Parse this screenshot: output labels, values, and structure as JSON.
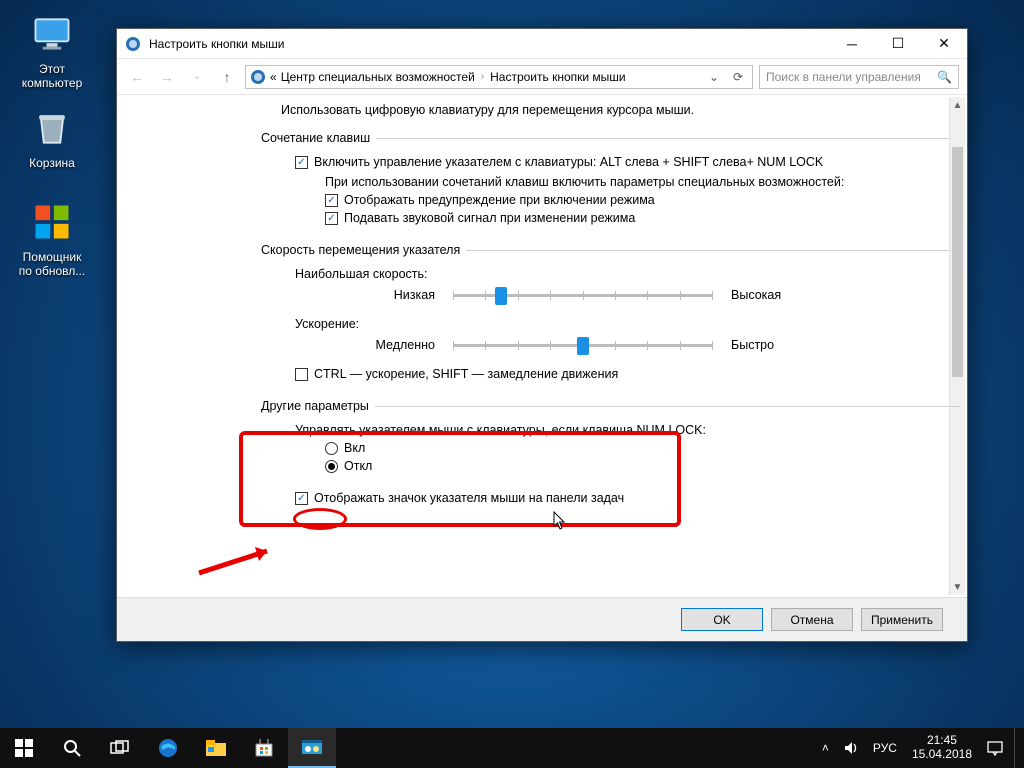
{
  "desktop": {
    "icons": {
      "computer": "Этот\nкомпьютер",
      "bin": "Корзина",
      "helper": "Помощник\nпо обновл..."
    }
  },
  "window": {
    "title": "Настроить кнопки мыши",
    "breadcrumb": {
      "root_sep": "«",
      "parent": "Центр специальных возможностей",
      "current": "Настроить кнопки мыши"
    },
    "search_placeholder": "Поиск в панели управления",
    "intro": "Использовать цифровую клавиатуру для перемещения курсора мыши.",
    "group_keys": {
      "legend": "Сочетание клавиш",
      "enable": "Включить управление указателем с клавиатуры: ALT слева + SHIFT слева+ NUM LOCK",
      "subhead": "При использовании сочетаний клавиш включить параметры специальных возможностей:",
      "warn": "Отображать предупреждение при включении режима",
      "sound": "Подавать звуковой сигнал при изменении режима"
    },
    "group_speed": {
      "legend": "Скорость перемещения указателя",
      "top_speed_label": "Наибольшая скорость:",
      "low": "Низкая",
      "high": "Высокая",
      "accel_label": "Ускорение:",
      "slow": "Медленно",
      "fast": "Быстро",
      "ctrl_shift": "CTRL — ускорение, SHIFT — замедление движения"
    },
    "group_other": {
      "legend": "Другие параметры",
      "subhead": "Управлять указателем мыши с клавиатуры, если клавиша NUM LOCK:",
      "on": "Вкл",
      "off": "Откл",
      "tray_icon": "Отображать значок указателя мыши на панели задач"
    },
    "buttons": {
      "ok": "OK",
      "cancel": "Отмена",
      "apply": "Применить"
    }
  },
  "taskbar": {
    "lang": "РУС",
    "time": "21:45",
    "date": "15.04.2018"
  }
}
